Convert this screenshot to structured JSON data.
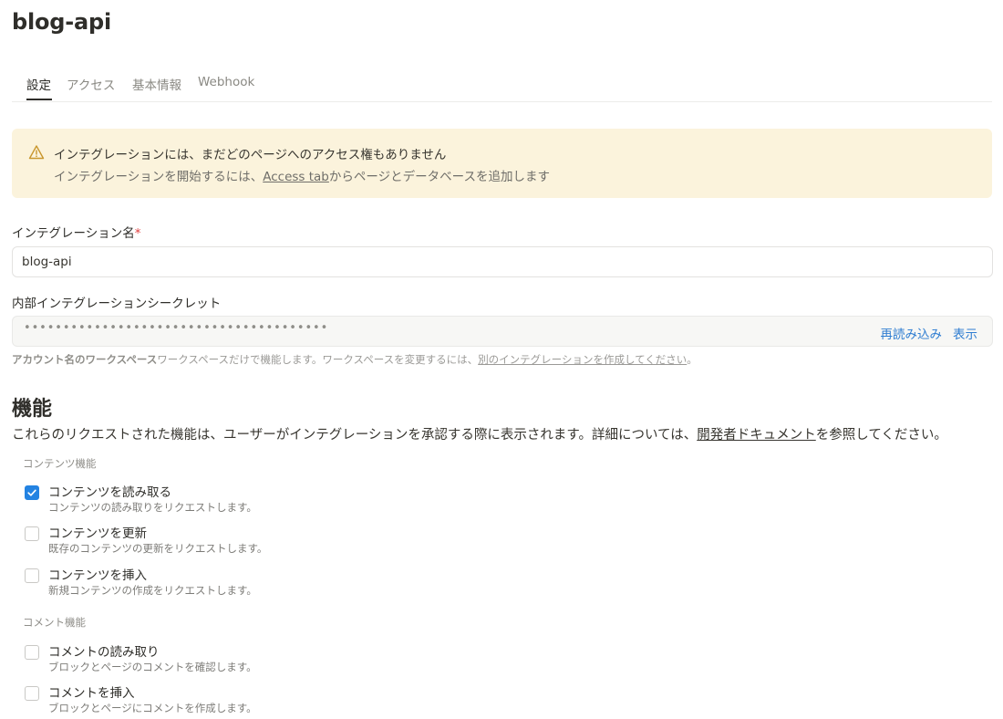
{
  "header": {
    "title": "blog-api"
  },
  "tabs": [
    {
      "label": "設定",
      "active": true
    },
    {
      "label": "アクセス",
      "active": false
    },
    {
      "label": "基本情報",
      "active": false
    },
    {
      "label": "Webhook",
      "active": false
    }
  ],
  "alert": {
    "icon": "warning-triangle-icon",
    "title": "インテグレーションには、まだどのページへのアクセス権もありません",
    "body_before": "インテグレーションを開始するには、",
    "body_link": "Access tab",
    "body_after": "からページとデータベースを追加します"
  },
  "name_field": {
    "label": "インテグレーション名",
    "required_mark": "*",
    "value": "blog-api"
  },
  "secret_field": {
    "label": "内部インテグレーションシークレット",
    "masked_value": "•••••••••••••••••••••••••••••••••••••••",
    "reload_label": "再読み込み",
    "show_label": "表示"
  },
  "workspace_help": {
    "workspace_name": "アカウント名のワークスペース",
    "text": "ワークスペースだけで機能します。ワークスペースを変更するには、",
    "link": "別のインテグレーションを作成してください",
    "suffix": "。"
  },
  "capabilities": {
    "title": "機能",
    "description_before": "これらのリクエストされた機能は、ユーザーがインテグレーションを承認する際に表示されます。詳細については、",
    "description_link": "開発者ドキュメント",
    "description_after": "を参照してください。",
    "content_group": {
      "label": "コンテンツ機能",
      "items": [
        {
          "title": "コンテンツを読み取る",
          "description": "コンテンツの読み取りをリクエストします。",
          "checked": true
        },
        {
          "title": "コンテンツを更新",
          "description": "既存のコンテンツの更新をリクエストします。",
          "checked": false
        },
        {
          "title": "コンテンツを挿入",
          "description": "新規コンテンツの作成をリクエストします。",
          "checked": false
        }
      ]
    },
    "comment_group": {
      "label": "コメント機能",
      "items": [
        {
          "title": "コメントの読み取り",
          "description": "ブロックとページのコメントを確認します。",
          "checked": false
        },
        {
          "title": "コメントを挿入",
          "description": "ブロックとページにコメントを作成します。",
          "checked": false
        }
      ]
    }
  },
  "colors": {
    "accent": "#2383e2",
    "link": "#2f7dd1",
    "alert_bg": "#fbf3dc",
    "required": "#e03e3e"
  }
}
